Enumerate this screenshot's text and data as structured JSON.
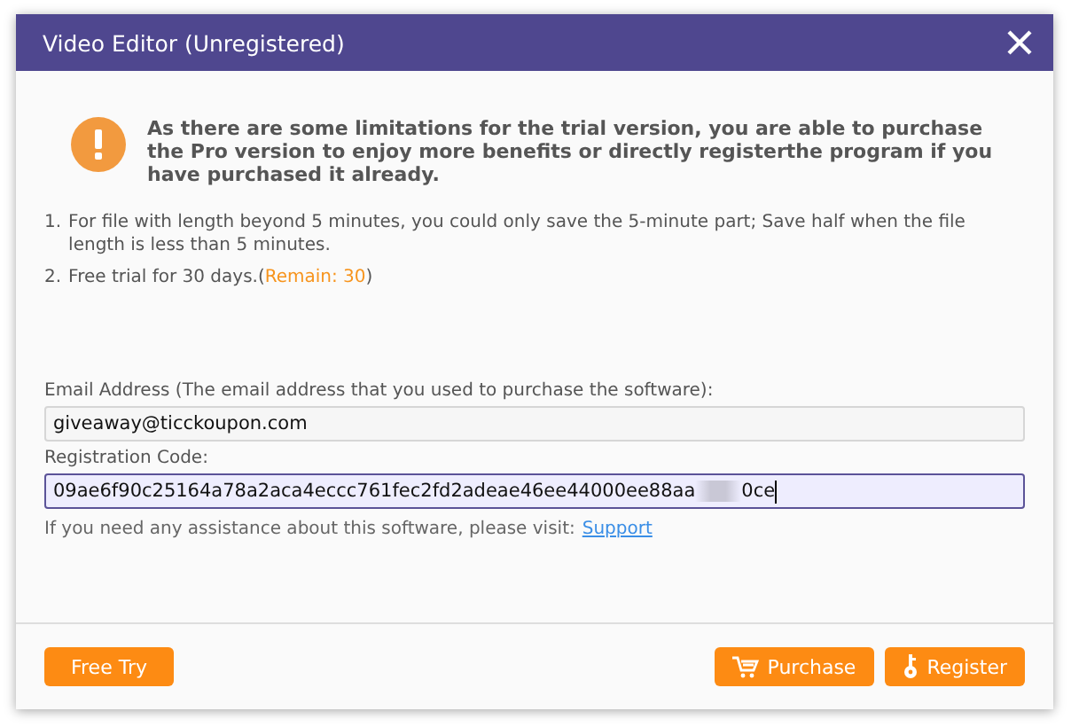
{
  "window": {
    "title": "Video Editor (Unregistered)"
  },
  "notice": "As there are some limitations for the trial version, you are able to purchase the Pro version to enjoy more benefits or directly registerthe program if you have purchased it already.",
  "limits": [
    {
      "number": "1.",
      "text": "For file with length beyond 5 minutes, you could only save the 5-minute part; Save half when the file length is less than 5 minutes."
    },
    {
      "number": "2.",
      "text": "Free trial for 30 days.(",
      "remain": "Remain: 30",
      "tail": ")"
    }
  ],
  "email": {
    "label": "Email Address (The email address that you used to purchase the software):",
    "value": "giveaway@ticckoupon.com"
  },
  "code": {
    "label": "Registration Code:",
    "value_start": "09ae6f90c25164a78a2aca4eccc761fec2fd2adeae46ee44000ee88aa",
    "value_end": "0ce",
    "focused": true
  },
  "support": {
    "text": "If you need any assistance about this software, please visit:",
    "link": "Support"
  },
  "buttons": [
    {
      "label": "Free Try",
      "kind": "plain"
    },
    {
      "label": "Purchase",
      "kind": "cart"
    },
    {
      "label": "Register",
      "kind": "key"
    }
  ]
}
